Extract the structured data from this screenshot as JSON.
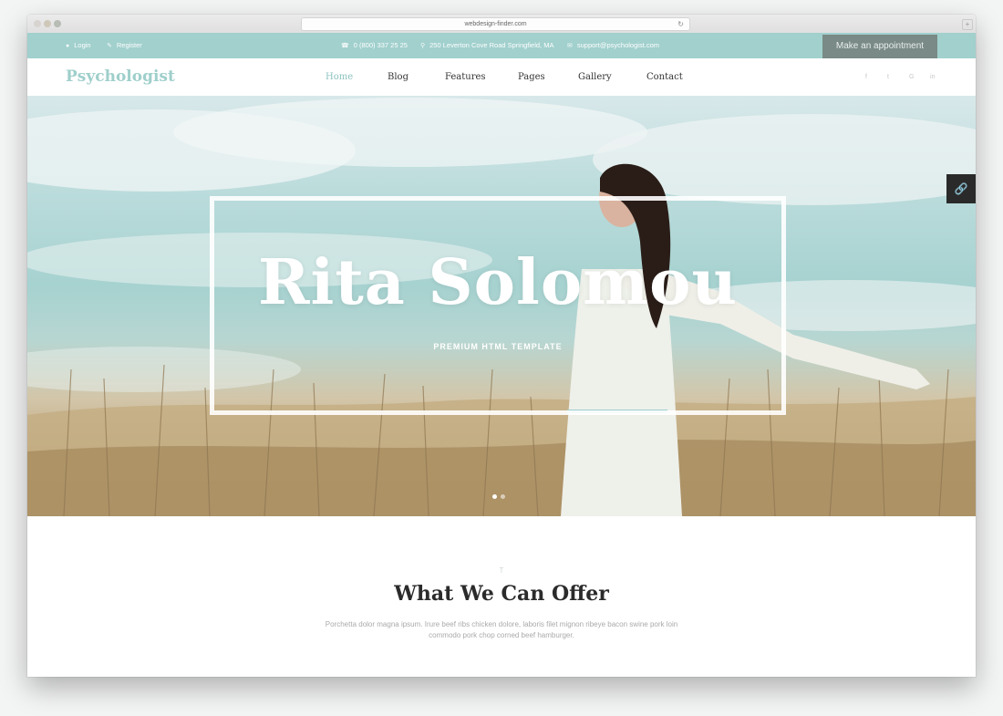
{
  "browser": {
    "url": "webdesign-finder.com"
  },
  "topbar": {
    "login": "Login",
    "register": "Register",
    "phone": "0 (800) 337 25 25",
    "address": "250 Leverton Cove Road Springfield, MA",
    "email": "support@psychologist.com",
    "appointment_button": "Make an appointment",
    "background_color": "#a1d0cd"
  },
  "nav": {
    "logo": "Psychologist",
    "links": [
      "Home",
      "Blog",
      "Features",
      "Pages",
      "Gallery",
      "Contact"
    ],
    "active": "Home",
    "social_icons": [
      "facebook-icon",
      "twitter-icon",
      "google-icon",
      "linkedin-icon"
    ],
    "social_glyphs": [
      "f",
      "t",
      "G",
      "in"
    ],
    "accent_color": "#8bc3bf"
  },
  "hero": {
    "title": "Rita Solomou",
    "subtitle": "PREMIUM HTML TEMPLATE",
    "side_button_icon": "link-icon"
  },
  "offer": {
    "mark": "T",
    "title": "What We Can Offer",
    "text": "Porchetta dolor magna ipsum. Irure beef ribs chicken dolore, laboris filet mignon ribeye bacon swine pork loin commodo pork chop corned beef hamburger."
  }
}
